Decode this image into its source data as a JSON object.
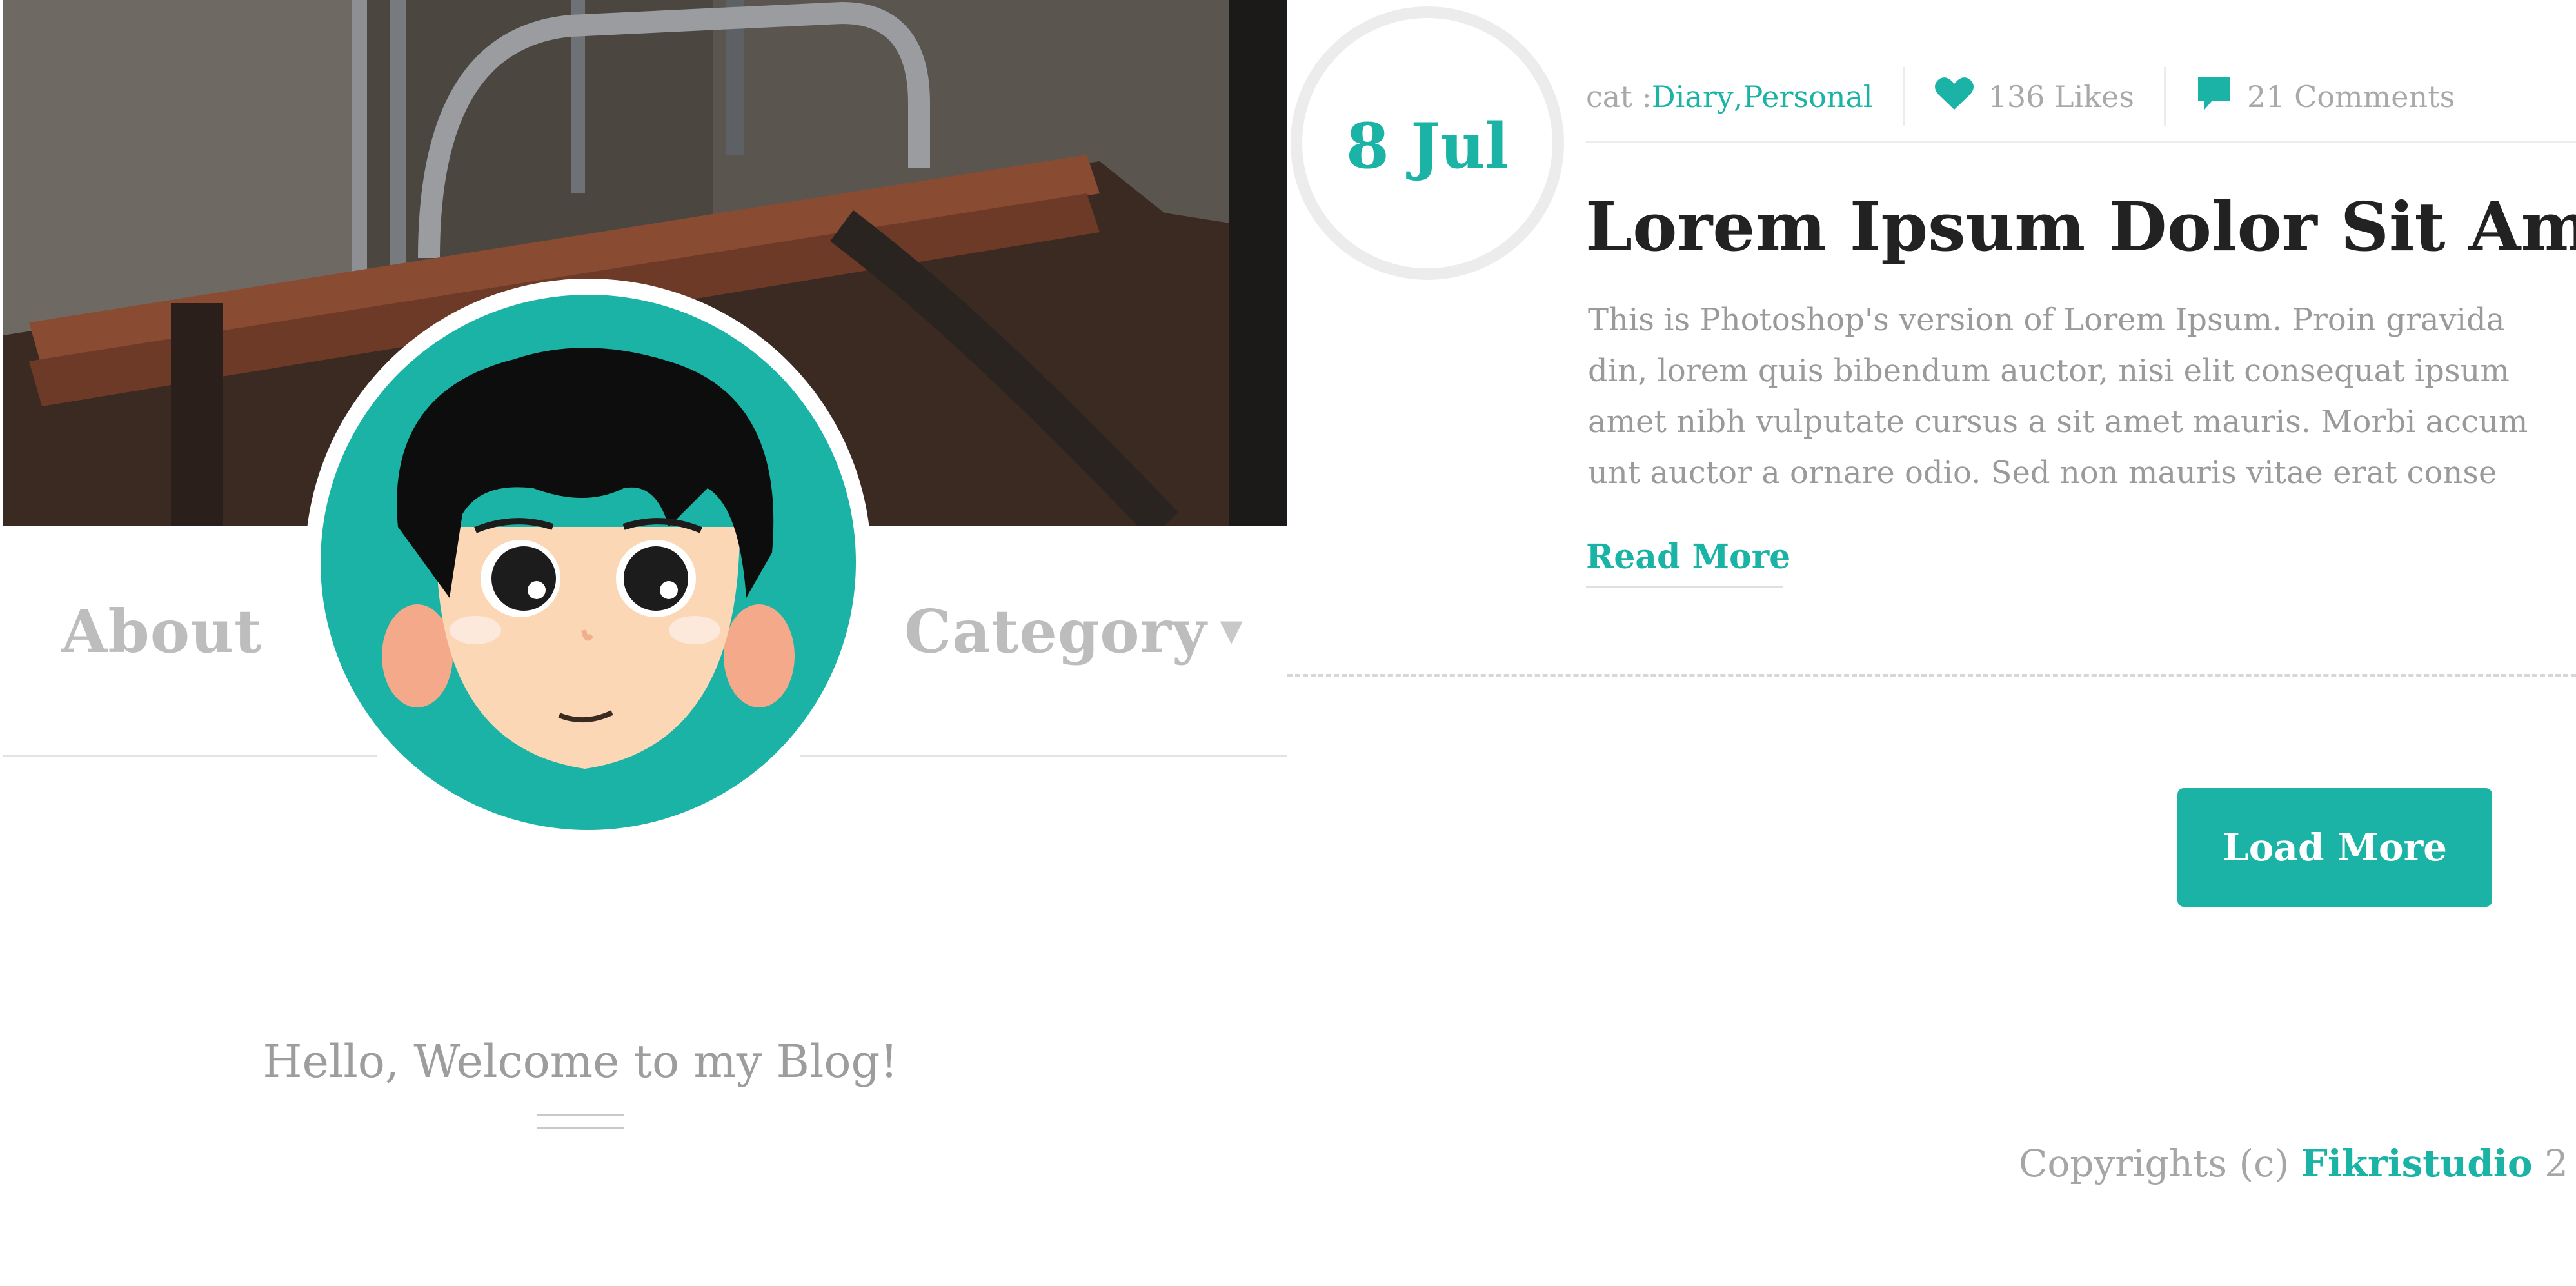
{
  "colors": {
    "accent": "#1ab3a5",
    "muted_text": "#9d9d9d",
    "title_text": "#222222",
    "nav_text": "#bdbdbd"
  },
  "profile": {
    "nav_left": "About",
    "nav_right": "Category",
    "nav_right_icon": "caret-down-icon",
    "avatar_icon": "cartoon-avatar-icon",
    "welcome": "Hello, Welcome to my Blog!"
  },
  "post": {
    "date": "8 Jul",
    "meta": {
      "cat_prefix": "cat : ",
      "cat_1": "Diary",
      "cat_sep": " , ",
      "cat_2": "Personal",
      "likes_icon": "heart-icon",
      "likes": "136 Likes",
      "comments_icon": "comment-icon",
      "comments": "21 Comments"
    },
    "title": "Lorem Ipsum Dolor Sit Amet",
    "body_lines": [
      "This is Photoshop's version  of Lorem Ipsum. Proin gravida",
      "din, lorem quis bibendum auctor, nisi elit consequat ipsum",
      "amet nibh vulputate cursus a sit amet mauris. Morbi accum",
      "unt auctor a ornare odio. Sed non  mauris vitae erat conse"
    ],
    "read_more": "Read More"
  },
  "load_more": "Load More",
  "footer": {
    "prefix": "Copyrights (c) ",
    "brand": "Fikristudio",
    "suffix": " 2"
  }
}
